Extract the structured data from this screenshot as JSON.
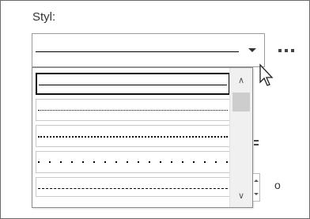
{
  "style_panel": {
    "label": "Styl:",
    "unit_suffix": "o",
    "dropdown": {
      "options": [
        {
          "name": "solid",
          "selected": true
        },
        {
          "name": "dotted-fine"
        },
        {
          "name": "dotted-medium"
        },
        {
          "name": "dotted-wide"
        },
        {
          "name": "dashed"
        }
      ]
    }
  }
}
